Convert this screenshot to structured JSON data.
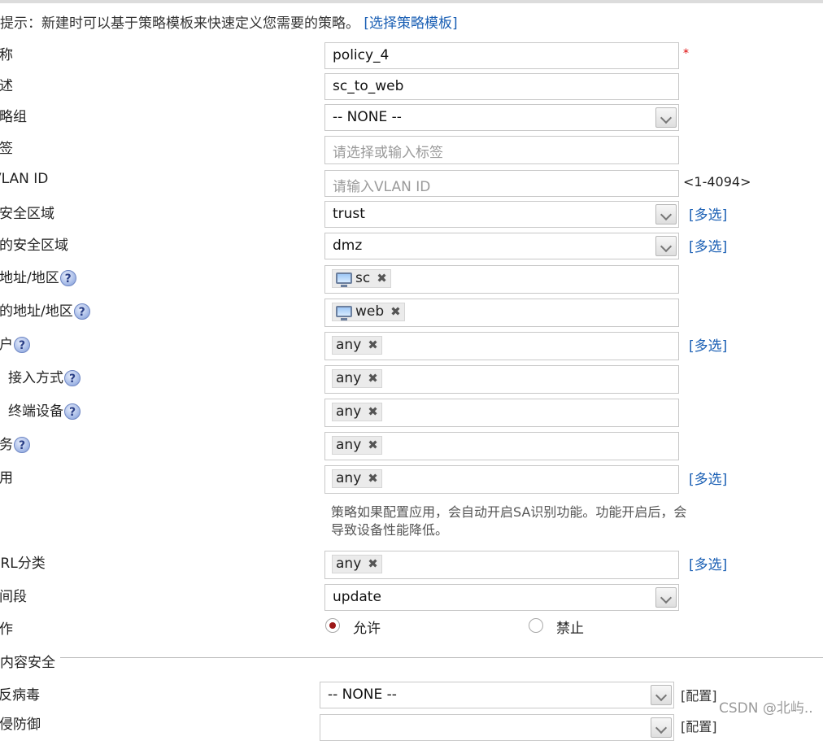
{
  "hint": {
    "text": "提示：新建时可以基于策略模板来快速定义您需要的策略。",
    "link": "[选择策略模板]"
  },
  "labels": {
    "name": "名称",
    "desc": "描述",
    "group": "策略组",
    "tag": "标签",
    "vlan": "VLAN ID",
    "src_zone": "源安全区域",
    "dst_zone": "目的安全区域",
    "src_addr": "源地址/地区",
    "dst_addr": "目的地址/地区",
    "user": "用户",
    "access": "接入方式",
    "device": "终端设备",
    "service": "服务",
    "app": "应用",
    "url": "URL分类",
    "time": "时间段",
    "action": "动作",
    "content_security": "内容安全",
    "antivirus": "反病毒",
    "intrusion": "入侵防御"
  },
  "fields": {
    "name_value": "policy_4",
    "desc_value": "sc_to_web",
    "group_value": "-- NONE --",
    "tag_placeholder": "请选择或输入标签",
    "vlan_placeholder": "请输入VLAN ID",
    "vlan_range": "<1-4094>",
    "src_zone_value": "trust",
    "dst_zone_value": "dmz",
    "src_addr_tag": "sc",
    "dst_addr_tag": "web",
    "any": "any",
    "time_value": "update",
    "antivirus_value": "-- NONE --"
  },
  "multi_select": "[多选]",
  "config_link": "[配置]",
  "required_mark": "*",
  "help_mark": "?",
  "remove_mark": "✖",
  "note": "策略如果配置应用，会自动开启SA识别功能。功能开启后，会导致设备性能降低。",
  "action": {
    "allow": "允许",
    "deny": "禁止",
    "selected": "allow"
  },
  "watermark": "CSDN @北屿.."
}
